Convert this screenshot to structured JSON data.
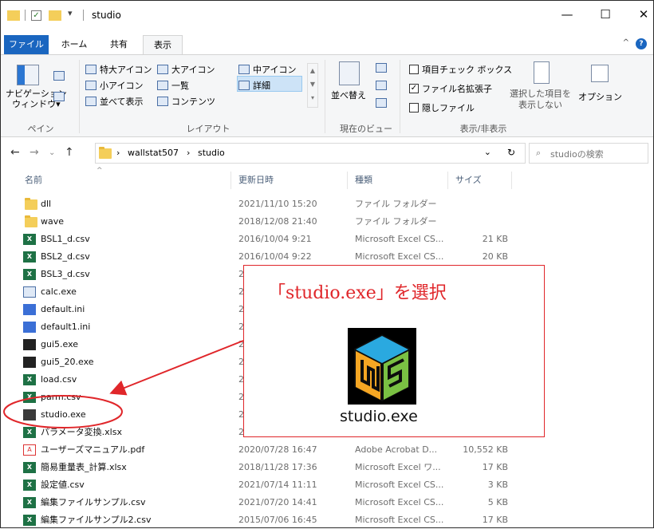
{
  "window": {
    "title": "studio",
    "controls": {
      "minimize": "—",
      "maximize": "☐",
      "close": "✕"
    }
  },
  "ribbon_tabs": [
    {
      "label": "ファイル"
    },
    {
      "label": "ホーム"
    },
    {
      "label": "共有"
    },
    {
      "label": "表示"
    }
  ],
  "ribbon": {
    "pane": {
      "nav_pane_line1": "ナビゲーション",
      "nav_pane_line2": "ウィンドウ▾",
      "group_label": "ペイン"
    },
    "layout": {
      "extra_large": "特大アイコン",
      "large": "大アイコン",
      "medium": "中アイコン",
      "small": "小アイコン",
      "list": "一覧",
      "details": "詳細",
      "tiles": "並べて表示",
      "content": "コンテンツ",
      "group_label": "レイアウト"
    },
    "current_view": {
      "sort_by": "並べ替え",
      "group_label": "現在のビュー"
    },
    "show_hide": {
      "item_checkboxes": "項目チェック ボックス",
      "file_extensions": "ファイル名拡張子",
      "hidden_items": "隠しファイル",
      "hide_selected_line1": "選択した項目を",
      "hide_selected_line2": "表示しない",
      "options": "オプション",
      "group_label": "表示/非表示"
    }
  },
  "address": {
    "crumbs": [
      "wallstat507",
      "studio"
    ],
    "search_placeholder": "studioの検索"
  },
  "columns": {
    "name": "名前",
    "date": "更新日時",
    "type": "種類",
    "size": "サイズ"
  },
  "files": [
    {
      "name": "dll",
      "date": "2021/11/10 15:20",
      "type": "ファイル フォルダー",
      "size": "",
      "icon": "folder"
    },
    {
      "name": "wave",
      "date": "2018/12/08 21:40",
      "type": "ファイル フォルダー",
      "size": "",
      "icon": "folder"
    },
    {
      "name": "BSL1_d.csv",
      "date": "2016/10/04 9:21",
      "type": "Microsoft Excel CS...",
      "size": "21 KB",
      "icon": "excel"
    },
    {
      "name": "BSL2_d.csv",
      "date": "2016/10/04 9:22",
      "type": "Microsoft Excel CS...",
      "size": "20 KB",
      "icon": "excel"
    },
    {
      "name": "BSL3_d.csv",
      "date": "2",
      "type": "",
      "size": "",
      "icon": "excel"
    },
    {
      "name": "calc.exe",
      "date": "2",
      "type": "",
      "size": "",
      "icon": "app"
    },
    {
      "name": "default.ini",
      "date": "2",
      "type": "",
      "size": "",
      "icon": "ini"
    },
    {
      "name": "default1.ini",
      "date": "2",
      "type": "",
      "size": "",
      "icon": "ini"
    },
    {
      "name": "gui5.exe",
      "date": "2",
      "type": "",
      "size": "",
      "icon": "gui"
    },
    {
      "name": "gui5_20.exe",
      "date": "2",
      "type": "",
      "size": "",
      "icon": "gui"
    },
    {
      "name": "load.csv",
      "date": "2",
      "type": "",
      "size": "",
      "icon": "excel"
    },
    {
      "name": "parm.csv",
      "date": "2",
      "type": "",
      "size": "",
      "icon": "excel"
    },
    {
      "name": "studio.exe",
      "date": "2",
      "type": "",
      "size": "",
      "icon": "studio"
    },
    {
      "name": "パラメータ変換.xlsx",
      "date": "2",
      "type": "",
      "size": "",
      "icon": "excel"
    },
    {
      "name": "ユーザーズマニュアル.pdf",
      "date": "2020/07/28 16:47",
      "type": "Adobe Acrobat D...",
      "size": "10,552 KB",
      "icon": "pdf"
    },
    {
      "name": "簡易重量表_計算.xlsx",
      "date": "2018/11/28 17:36",
      "type": "Microsoft Excel ワ...",
      "size": "17 KB",
      "icon": "excel"
    },
    {
      "name": "設定値.csv",
      "date": "2021/07/14 11:11",
      "type": "Microsoft Excel CS...",
      "size": "3 KB",
      "icon": "excel"
    },
    {
      "name": "編集ファイルサンプル.csv",
      "date": "2021/07/20 14:41",
      "type": "Microsoft Excel CS...",
      "size": "5 KB",
      "icon": "excel"
    },
    {
      "name": "編集ファイルサンプル2.csv",
      "date": "2015/07/06 16:45",
      "type": "Microsoft Excel CS...",
      "size": "17 KB",
      "icon": "excel"
    }
  ],
  "annotation": {
    "title": "「studio.exe」を選択",
    "caption": "studio.exe",
    "color": "#e0262a"
  }
}
